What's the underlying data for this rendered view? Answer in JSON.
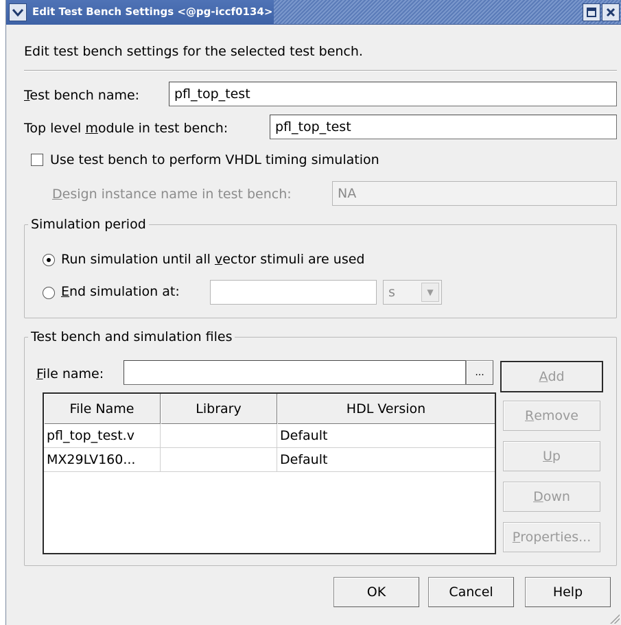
{
  "window": {
    "title": "Edit Test Bench Settings <@pg-iccf0134>",
    "menu_icon": "chevron-down-icon",
    "maximize_icon": "maximize-icon",
    "close_icon": "close-icon"
  },
  "description": "Edit test bench settings for the selected test bench.",
  "fields": {
    "test_bench_name": {
      "label_pre": "",
      "label_key": "T",
      "label_post": "est bench name:",
      "value": "pfl_top_test"
    },
    "top_level_module": {
      "label_pre": "Top level ",
      "label_key": "m",
      "label_post": "odule in test bench:",
      "value": "pfl_top_test"
    },
    "vhdl_timing": {
      "label": "Use test bench to perform VHDL timing simulation",
      "checked": false
    },
    "design_instance": {
      "label_pre": "",
      "label_key": "D",
      "label_post": "esign instance name in test bench:",
      "value": "NA"
    }
  },
  "simulation_period": {
    "title": "Simulation period",
    "run_all": {
      "label_pre": "Run simulation until all ",
      "label_key": "v",
      "label_post": "ector stimuli are used",
      "selected": true
    },
    "end_at": {
      "label_pre": "",
      "label_key": "E",
      "label_post": "nd simulation at:",
      "selected": false,
      "value": "",
      "unit": "s"
    }
  },
  "files_group": {
    "title": "Test bench and simulation files",
    "file_name": {
      "label_pre": "",
      "label_key": "F",
      "label_post": "ile name:",
      "value": "",
      "browse_label": "..."
    },
    "buttons": {
      "add": {
        "pre": "",
        "key": "A",
        "post": "dd"
      },
      "remove": {
        "pre": "",
        "key": "R",
        "post": "emove"
      },
      "up": {
        "pre": "",
        "key": "U",
        "post": "p"
      },
      "down": {
        "pre": "",
        "key": "D",
        "post": "own"
      },
      "properties": {
        "pre": "",
        "key": "P",
        "post": "roperties..."
      }
    },
    "table": {
      "columns": [
        "File Name",
        "Library",
        "HDL Version"
      ],
      "rows": [
        [
          "pfl_top_test.v",
          "",
          "Default"
        ],
        [
          "MX29LV160...",
          "",
          "Default"
        ]
      ]
    }
  },
  "footer": {
    "ok": "OK",
    "cancel": "Cancel",
    "help": "Help"
  }
}
